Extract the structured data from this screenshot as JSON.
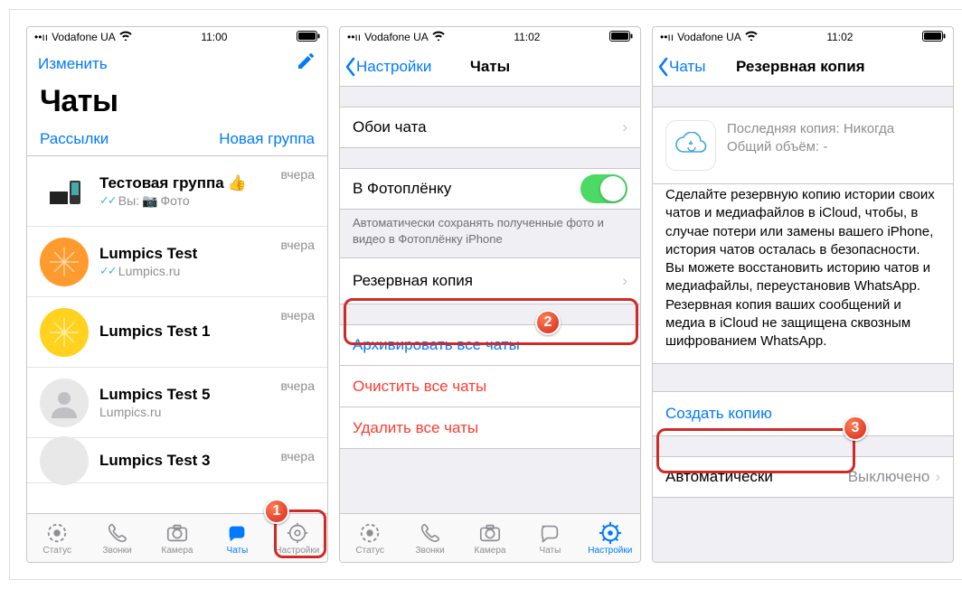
{
  "status": {
    "carrier": "Vodafone UA",
    "time1": "11:00",
    "time2": "11:02",
    "time3": "11:02"
  },
  "s1": {
    "edit": "Изменить",
    "title": "Чаты",
    "broadcasts": "Рассылки",
    "newgroup": "Новая группа",
    "chats": [
      {
        "name": "Тестовая группа",
        "emoji": "👍",
        "msg_prefix": "Вы:",
        "msg": "Фото",
        "time": "вчера",
        "ticks": true,
        "camera": true
      },
      {
        "name": "Lumpics Test",
        "msg": "Lumpics.ru",
        "time": "вчера",
        "ticks": true
      },
      {
        "name": "Lumpics Test 1",
        "msg": "",
        "time": "вчера"
      },
      {
        "name": "Lumpics Test 5",
        "msg": "Lumpics.ru",
        "time": "вчера"
      },
      {
        "name": "Lumpics Test 3",
        "msg": "",
        "time": "вчера"
      }
    ]
  },
  "tabs": {
    "status": "Статус",
    "calls": "Звонки",
    "camera": "Камера",
    "chats": "Чаты",
    "settings": "Настройки"
  },
  "s2": {
    "back": "Настройки",
    "title": "Чаты",
    "wallpaper": "Обои чата",
    "toCameraRoll": "В Фотоплёнку",
    "cameraRollFooter": "Автоматически сохранять полученные фото и видео в Фотоплёнку iPhone",
    "backup": "Резервная копия",
    "archiveAll": "Архивировать все чаты",
    "clearAll": "Очистить все чаты",
    "deleteAll": "Удалить все чаты"
  },
  "s3": {
    "back": "Чаты",
    "title": "Резервная копия",
    "lastBackup": "Последняя копия: Никогда",
    "totalSize": "Общий объём: -",
    "desc": "Сделайте резервную копию истории своих чатов и медиафайлов в iCloud, чтобы, в случае потери или замены вашего iPhone, история чатов осталась в безопасности. Вы можете восстановить историю чатов и медиафайлы, переустановив WhatsApp. Резервная копия ваших сообщений и медиа в iCloud не защищена сквозным шифрованием WhatsApp.",
    "createBackup": "Создать копию",
    "auto": "Автоматически",
    "autoValue": "Выключено"
  }
}
